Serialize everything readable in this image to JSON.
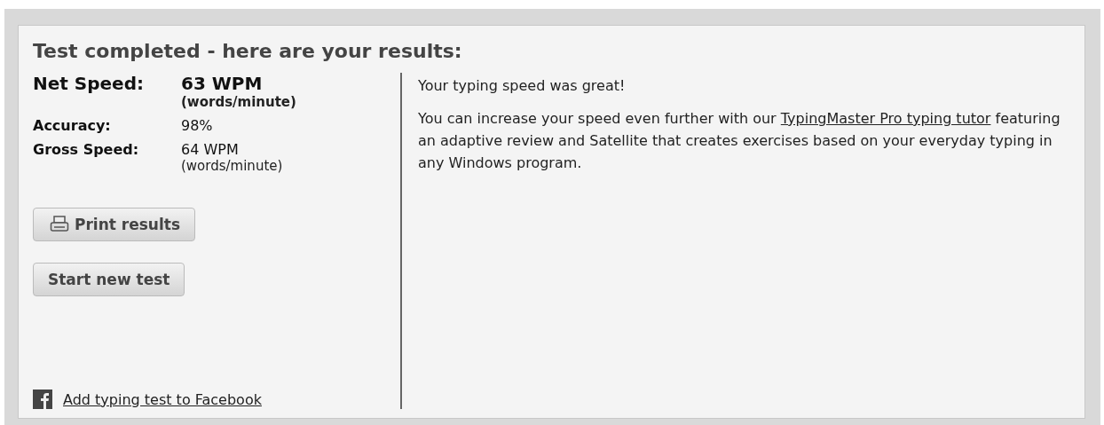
{
  "title": "Test completed - here are your results:",
  "net_speed": {
    "label": "Net Speed:",
    "value": "63 WPM",
    "unit": "(words/minute)"
  },
  "stats": [
    {
      "label": "Accuracy:",
      "value": "98%"
    },
    {
      "label": "Gross Speed:",
      "value": "64 WPM",
      "unit": "(words/minute)"
    }
  ],
  "buttons": [
    {
      "label": "Print results",
      "kind": "print"
    },
    {
      "label": "Start new test",
      "kind": "plain"
    }
  ],
  "facebook_link": "Add typing test to Facebook",
  "message": "Your typing speed was great!",
  "promo": {
    "before": "You can increase your speed even further with our",
    "link": "TypingMaster Pro typing tutor",
    "after": "featuring an adaptive review and Satellite that creates exercises based on your everyday typing in any Windows program."
  }
}
